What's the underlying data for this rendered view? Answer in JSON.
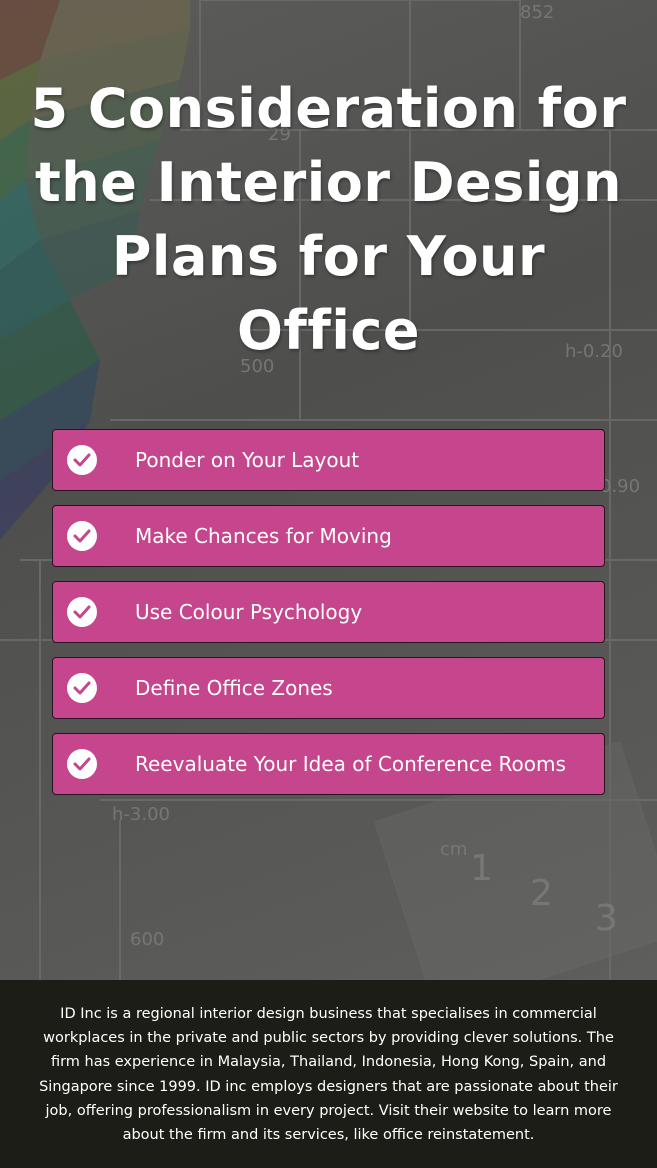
{
  "colors": {
    "accent": "#c5468c",
    "footer_bg": "#1c1d17",
    "text": "#ffffff"
  },
  "header": {
    "title": "5 Consideration for the Interior Design Plans for Your Office"
  },
  "considerations": [
    {
      "label": "Ponder on Your Layout",
      "icon": "check-circle-icon"
    },
    {
      "label": "Make Chances for Moving",
      "icon": "check-circle-icon"
    },
    {
      "label": "Use Colour Psychology",
      "icon": "check-circle-icon"
    },
    {
      "label": "Define Office Zones",
      "icon": "check-circle-icon"
    },
    {
      "label": "Reevaluate Your Idea of Conference Rooms",
      "icon": "check-circle-icon"
    }
  ],
  "footer": {
    "text": "ID Inc is a regional interior design business that specialises in commercial workplaces in the private and public sectors by providing clever solutions. The firm has experience in Malaysia, Thailand, Indonesia, Hong Kong, Spain, and Singapore since 1999. ID inc employs designers that are passionate about their job, offering professionalism in every project. Visit their website to learn more about the firm and its services, like office reinstatement."
  }
}
